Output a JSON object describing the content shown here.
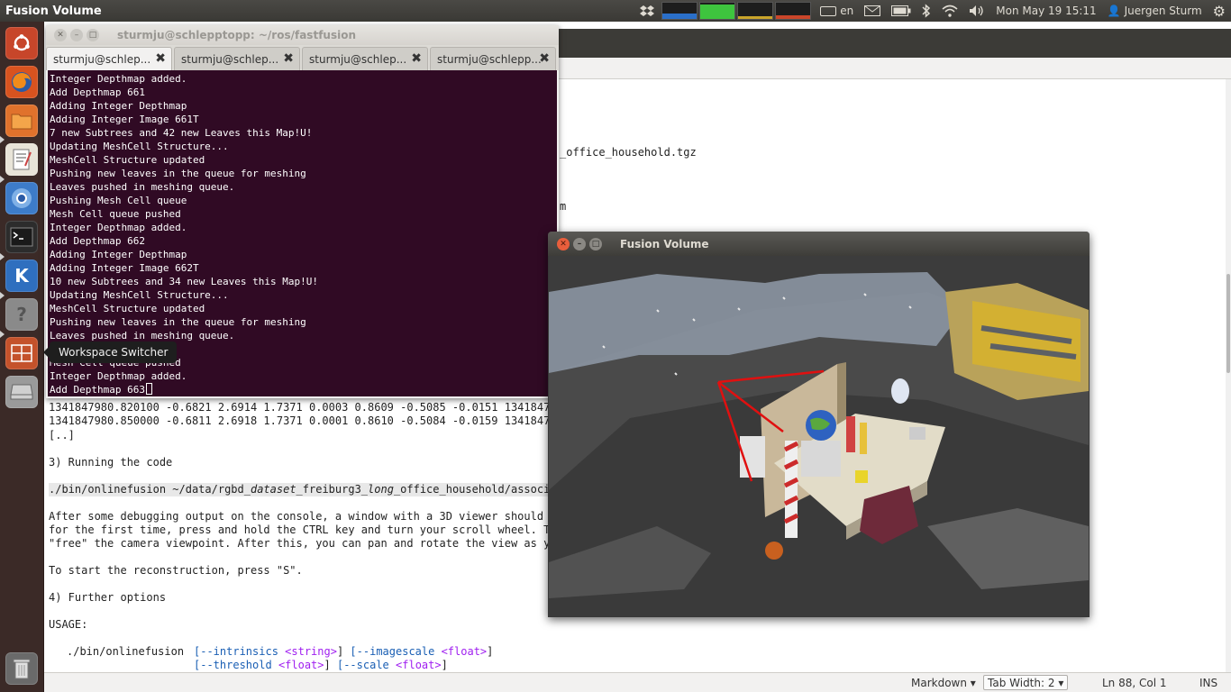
{
  "top_panel": {
    "active_title": "Fusion Volume",
    "keyboard_layout": "en",
    "clock": "Mon May 19 15:11",
    "user": "Juergen Sturm"
  },
  "launcher": {
    "tooltip": "Workspace Switcher",
    "icons": [
      "ubuntu-dash-icon",
      "firefox-icon",
      "files-icon",
      "text-editor-icon",
      "chromium-icon",
      "terminal-icon",
      "kde-app-icon",
      "help-icon",
      "workspace-switcher-icon",
      "disk-icon",
      "trash-icon"
    ]
  },
  "terminal": {
    "title": "sturmju@schlepptopp: ~/ros/fastfusion",
    "tabs": [
      "sturmju@schlep...",
      "sturmju@schlep...",
      "sturmju@schlep...",
      "sturmju@schlepp..."
    ],
    "lines": [
      "Integer Depthmap added.",
      "Add Depthmap 661",
      "Adding Integer Depthmap",
      "Adding Integer Image 661T",
      "7 new Subtrees and 42 new Leaves this Map!U!",
      "Updating MeshCell Structure...",
      "MeshCell Structure updated",
      "Pushing new leaves in the queue for meshing",
      "Leaves pushed in meshing queue.",
      "Pushing Mesh Cell queue",
      "Mesh Cell queue pushed",
      "Integer Depthmap added.",
      "Add Depthmap 662",
      "Adding Integer Depthmap",
      "Adding Integer Image 662T",
      "10 new Subtrees and 34 new Leaves this Map!U!",
      "Updating MeshCell Structure...",
      "MeshCell Structure updated",
      "Pushing new leaves in the queue for meshing",
      "Leaves pushed in meshing queue.",
      "              ueue",
      "Mesh Cell queue pushed",
      "Integer Depthmap added."
    ],
    "last_line": "Add Depthmap 663"
  },
  "editor": {
    "right_fragments": {
      "tgz": "_office_household.tgz",
      "m": "m"
    },
    "lines": {
      "data1": "1341847980.820100 -0.6821 2.6914 1.7371 0.0003 0.8609 -0.5085 -0.0151 1341847980",
      "data2": "1341847980.850000 -0.6811 2.6918 1.7371 0.0001 0.8610 -0.5084 -0.0159 1341847980",
      "ellipsis": "[..]",
      "running": "3) Running the code",
      "cmd_a": "./bin/onlinefusion ~/data/rgbd_",
      "cmd_b": "dataset",
      "cmd_c": "_freiburg3_",
      "cmd_d": "long",
      "cmd_e": "_office_household/associat",
      "para1": "After some debugging output on the console, a window with a 3D viewer should op",
      "para2": "for the first time, press and hold the CTRL key and turn your scroll wheel. Thi",
      "para3": "\"free\" the camera viewpoint. After this, you can pan and rotate the view as you",
      "start": "To start the reconstruction, press \"S\".",
      "further": "4) Further options",
      "usage": "USAGE:",
      "usage_cmd": "./bin/onlinefusion",
      "opt1_key": "[--intrinsics",
      "opt1_type": "<string>",
      "opt1_close": "]",
      "opt2_key": "[--imagescale",
      "opt2_type": "<float>",
      "opt2_close": "]",
      "opt3_key": "[--threshold",
      "opt3_type": "<float>",
      "opt3_close": "]",
      "opt4_key": "[--scale",
      "opt4_type": "<float>",
      "opt4_close": "]"
    },
    "status": {
      "language": "Markdown",
      "tab_width": "Tab Width: 2",
      "position": "Ln 88, Col 1",
      "mode": "INS"
    }
  },
  "fusion_window": {
    "title": "Fusion Volume"
  },
  "colors": {
    "terminal_bg": "#300a24",
    "launcher_bg": "#3b2a27",
    "panel_bg": "#3c3b37",
    "close_button": "#e85e3c"
  }
}
